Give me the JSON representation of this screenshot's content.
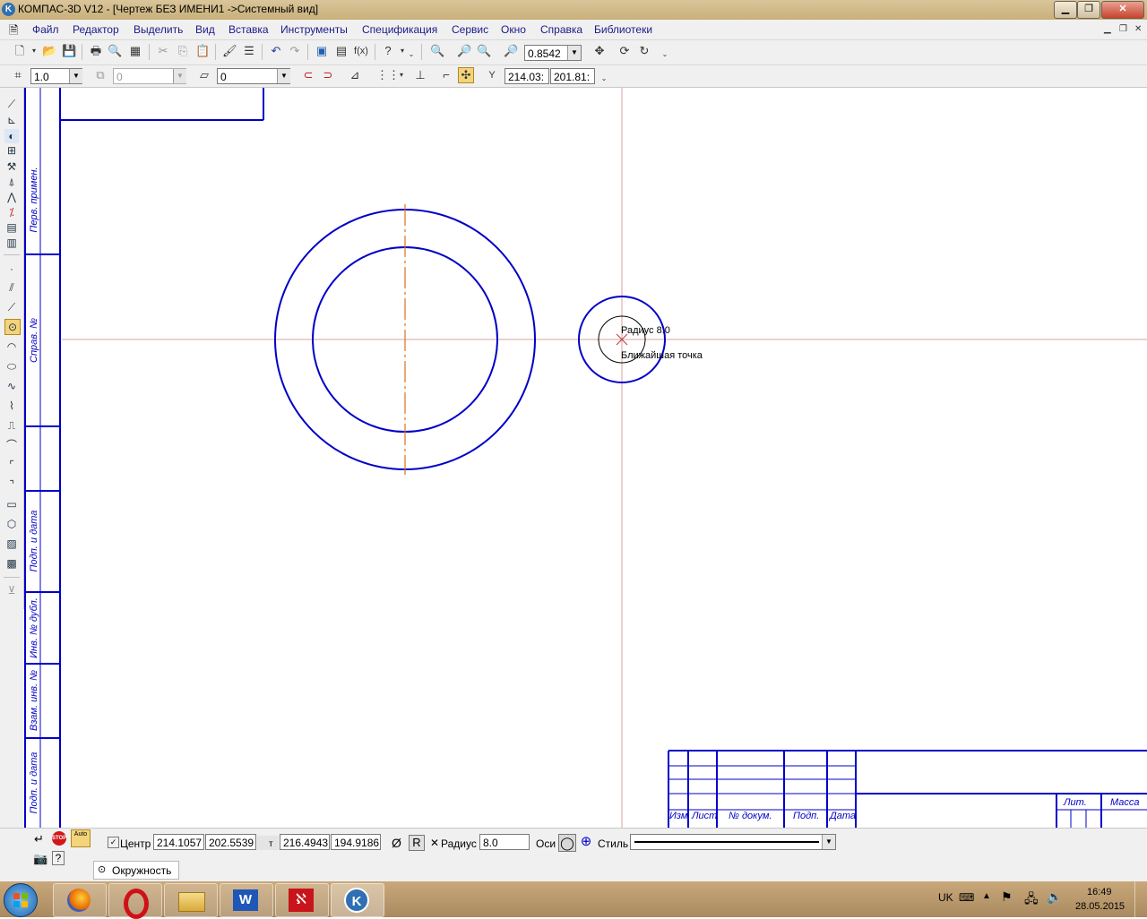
{
  "window": {
    "title": "КОМПАС-3D V12 - [Чертеж БЕЗ ИМЕНИ1 ->Системный вид]",
    "app_icon_letter": "K"
  },
  "menu": [
    "Файл",
    "Редактор",
    "Выделить",
    "Вид",
    "Вставка",
    "Инструменты",
    "Спецификация",
    "Сервис",
    "Окно",
    "Справка",
    "Библиотеки"
  ],
  "toolbar1": {
    "zoom_value": "0.8542"
  },
  "toolbar2": {
    "step_value": "1.0",
    "layer_value": "0",
    "style_value": "0",
    "coord_x": "214.03:",
    "coord_y": "201.81:",
    "y_prefix": "Y"
  },
  "canvas": {
    "stamp_labels": [
      "Перв. примен.",
      "Справ. №",
      "Подп. и дата",
      "Инв. № дубл.",
      "Взам. инв. №",
      "Подп. и дата"
    ],
    "title_block": {
      "col_labels": [
        "Изм.",
        "Лист",
        "№ докум.",
        "Подп.",
        "Дата"
      ],
      "lit_label": "Лит.",
      "mass_label": "Масса"
    },
    "tooltip_radius": "Радиус 8.0",
    "tooltip_snap": "Ближайшая точка",
    "colors": {
      "geometry": "#0000c8",
      "axis": "#e07020",
      "crosshair": "#c87878"
    }
  },
  "propbar": {
    "center_label": "Центр",
    "center_x": "214.1057",
    "center_y": "202.5539",
    "point_x": "216.4943",
    "point_y": "194.9186",
    "point_symbol": "т",
    "diameter_symbol": "Ø",
    "radius_symbol": "R",
    "radius_label": "Радиус",
    "radius_value": "8.0",
    "axes_label": "Оси",
    "style_label": "Стиль",
    "stop_label": "STOP",
    "auto_label": "Auto",
    "tab_label": "Окружность"
  },
  "taskbar": {
    "lang": "UK",
    "time": "16:49",
    "date": "28.05.2015",
    "apps": [
      "windows-start",
      "firefox",
      "opera",
      "file-explorer",
      "word",
      "acrobat",
      "kompas"
    ]
  }
}
